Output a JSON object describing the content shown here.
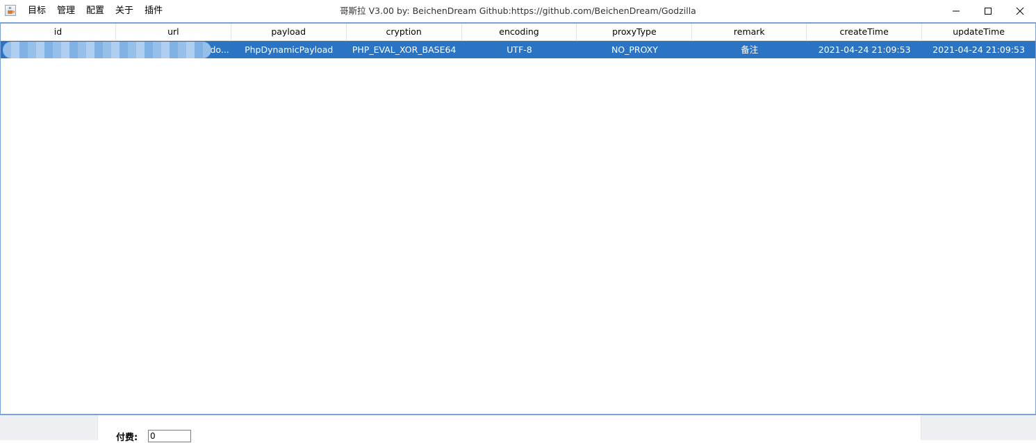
{
  "menu": {
    "items": [
      "目标",
      "管理",
      "配置",
      "关于",
      "插件"
    ]
  },
  "window": {
    "title": "哥斯拉 V3.00 by: BeichenDream Github:https://github.com/BeichenDream/Godzilla"
  },
  "table": {
    "columns": [
      "id",
      "url",
      "payload",
      "cryption",
      "encoding",
      "proxyType",
      "remark",
      "createTime",
      "updateTime"
    ],
    "rows": [
      {
        "id": "",
        "url": "do...",
        "payload": "PhpDynamicPayload",
        "cryption": "PHP_EVAL_XOR_BASE64",
        "encoding": "UTF-8",
        "proxyType": "NO_PROXY",
        "remark": "备注",
        "createTime": "2021-04-24 21:09:53",
        "updateTime": "2021-04-24 21:09:53"
      }
    ]
  },
  "bottom": {
    "fee_label": "付费:",
    "fee_value": "0"
  },
  "colors": {
    "selection": "#2b74c4",
    "table_border": "#7aa2d6",
    "bottom_bg": "#eef0f4"
  },
  "icons": {
    "app": "java-cup-icon",
    "minimize": "minimize-icon",
    "maximize": "maximize-icon",
    "close": "close-icon"
  }
}
